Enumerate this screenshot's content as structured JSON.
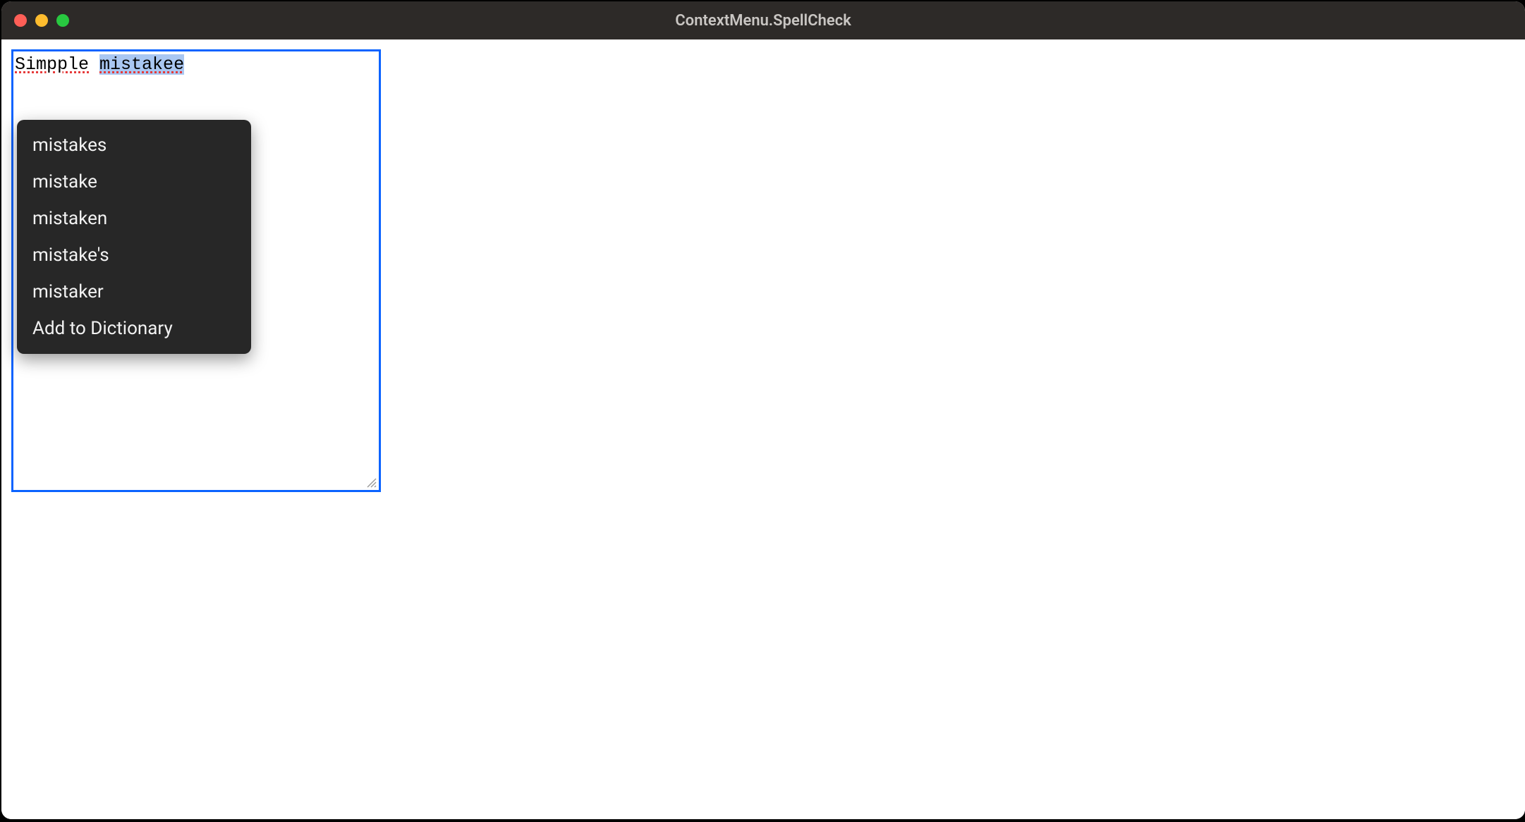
{
  "window": {
    "title": "ContextMenu.SpellCheck"
  },
  "textarea": {
    "word1": "Simpple",
    "word2": "mistakee"
  },
  "contextMenu": {
    "items": [
      {
        "label": "mistakes"
      },
      {
        "label": "mistake"
      },
      {
        "label": "mistaken"
      },
      {
        "label": "mistake's"
      },
      {
        "label": "mistaker"
      },
      {
        "label": "Add to Dictionary"
      }
    ]
  }
}
